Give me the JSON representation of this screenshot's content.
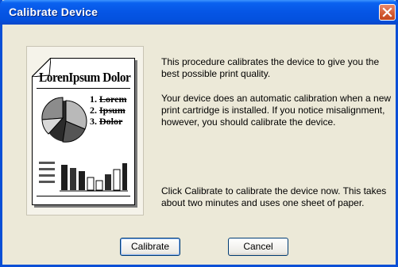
{
  "window": {
    "title": "Calibrate Device"
  },
  "illustration": {
    "heading": "LorenIpsum Dolor",
    "list_items": [
      "Lorem",
      "Ipsum",
      "Dolor"
    ]
  },
  "content": {
    "paragraph_1": "This procedure calibrates the device to give you the best possible print quality.",
    "paragraph_2": "Your device does an automatic calibration when a new print cartridge is installed.  If you notice misalignment, however, you should calibrate the device.",
    "paragraph_3": "Click Calibrate to calibrate the device now.  This takes about two minutes and uses one sheet of paper."
  },
  "buttons": {
    "calibrate_label": "Calibrate",
    "cancel_label": "Cancel"
  },
  "colors": {
    "title_bar": "#0656e6",
    "close_button": "#d35a32",
    "dialog_background": "#ece9d8"
  },
  "icons": {
    "close": "close-icon"
  }
}
